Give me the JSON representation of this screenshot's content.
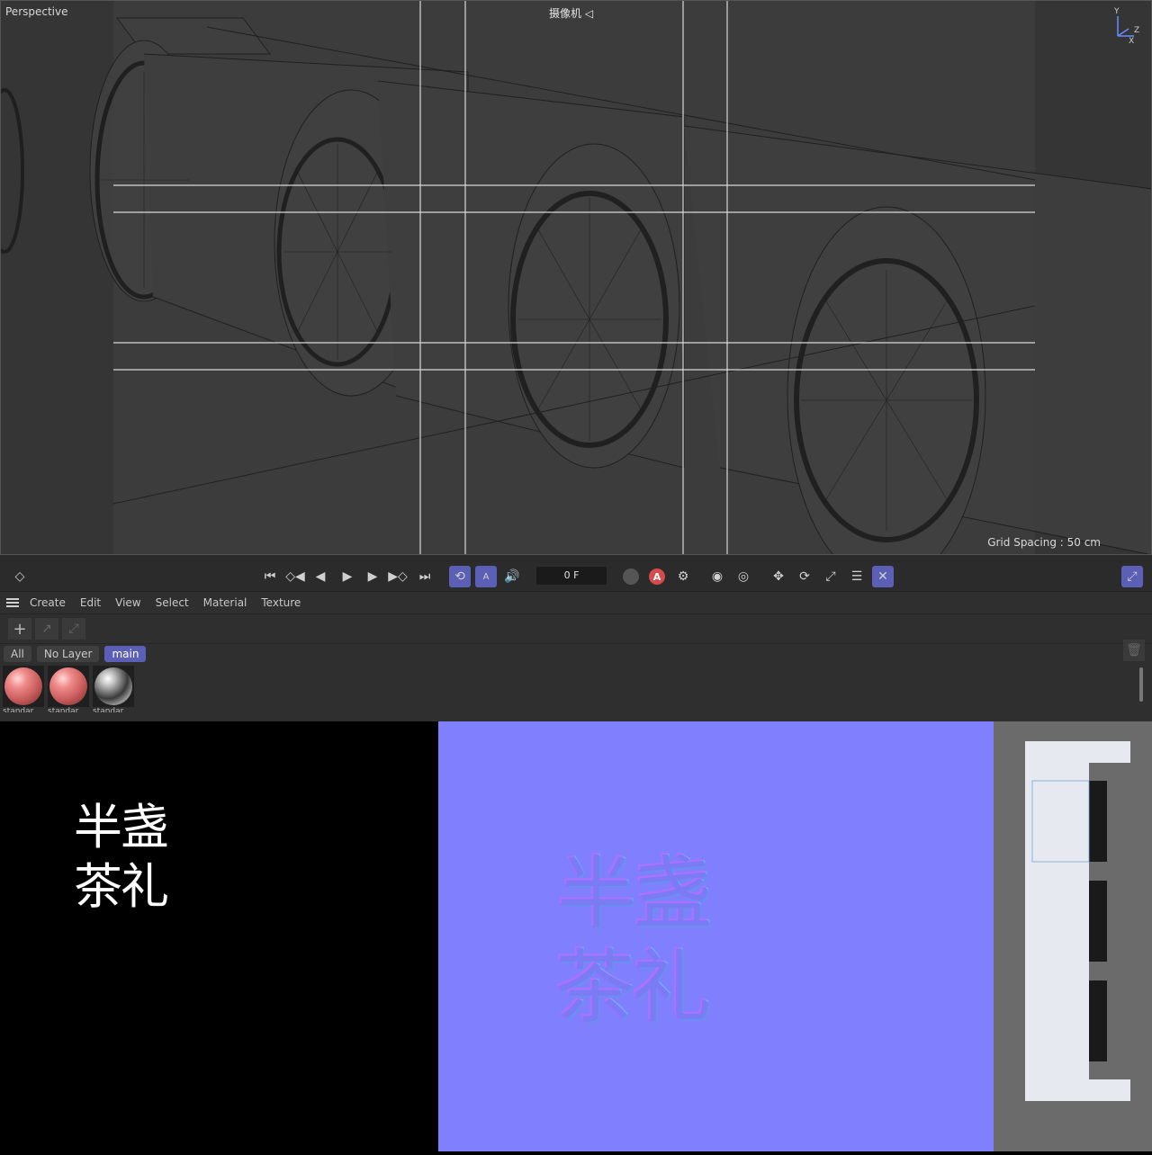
{
  "viewport": {
    "view_label": "Perspective",
    "camera_label": "摄像机 ◁",
    "grid_spacing": "Grid Spacing : 50 cm",
    "axis": {
      "y": "Y",
      "z": "Z",
      "x": "X"
    }
  },
  "timeline": {
    "frame": "0 F",
    "record_label": "A"
  },
  "material_manager": {
    "menu": [
      "Create",
      "Edit",
      "View",
      "Select",
      "Material",
      "Texture"
    ],
    "tabs": [
      "All",
      "No Layer",
      "main"
    ],
    "selected_tab": "main",
    "materials": [
      {
        "name": "standar",
        "kind": "pink"
      },
      {
        "name": "standar",
        "kind": "pink"
      },
      {
        "name": "standar",
        "kind": "chrome"
      }
    ]
  },
  "textures": {
    "alpha_line1": "半盏",
    "alpha_line2": "茶礼",
    "normal_line1": "半盏",
    "normal_line2": "茶礼"
  },
  "colors": {
    "accent": "#5b5fb5",
    "normal_map": "#8080ff",
    "viewport_bg": "#3b3b3b"
  }
}
